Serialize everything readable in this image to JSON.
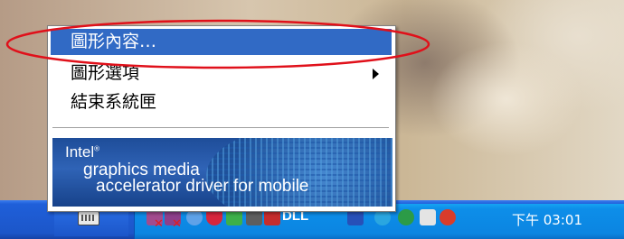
{
  "context_menu": {
    "items": [
      {
        "label": "圖形內容…",
        "selected": true
      },
      {
        "label": "圖形選項",
        "has_submenu": true
      },
      {
        "label": "結束系統匣"
      }
    ],
    "banner": {
      "brand": "Intel",
      "line1": "graphics media",
      "line2": "accelerator driver for mobile"
    }
  },
  "taskbar": {
    "tray_icons": [
      "keyboard-icon",
      "network-disabled-icon",
      "network-disabled-icon",
      "tool-icon",
      "shield-icon",
      "tool-icon",
      "monitor-icon",
      "speaker-icon",
      "dll-icon",
      "display-icon",
      "globe-icon",
      "network-icon",
      "antivirus-icon"
    ],
    "tray_text": "DLL",
    "clock": "下午 03:01"
  },
  "colors": {
    "menu_highlight": "#316ac5",
    "annotation": "#e0101a",
    "taskbar": "#1c56c9",
    "tray": "#0c85e1"
  }
}
